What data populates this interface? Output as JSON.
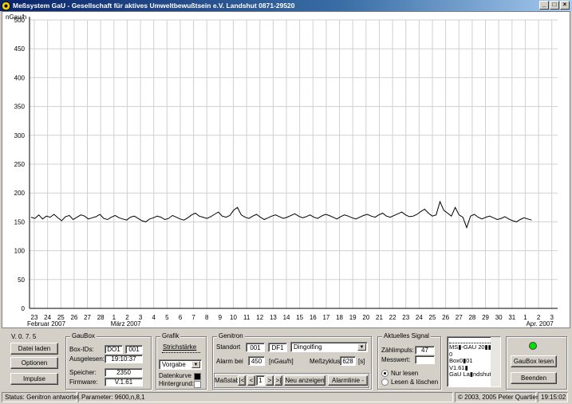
{
  "title": "Meßsystem GaU - Gesellschaft für aktives Umweltbewußtsein e.V.  Landshut 0871-29520",
  "window_buttons": {
    "min": "_",
    "max": "□",
    "close": "×"
  },
  "chart_data": {
    "type": "line",
    "ylabel": "nGau/h",
    "ylim": [
      0,
      500
    ],
    "yticks": [
      0,
      50,
      100,
      150,
      200,
      250,
      300,
      350,
      400,
      450,
      500
    ],
    "x_day_labels": [
      "23",
      "24",
      "25",
      "26",
      "27",
      "28",
      "1",
      "2",
      "3",
      "4",
      "5",
      "6",
      "7",
      "8",
      "9",
      "10",
      "11",
      "12",
      "13",
      "14",
      "15",
      "16",
      "17",
      "18",
      "19",
      "20",
      "21",
      "22",
      "23",
      "24",
      "25",
      "26",
      "27",
      "28",
      "29",
      "30",
      "31",
      "1",
      "2",
      "3"
    ],
    "month_labels": [
      "Februar 2007",
      "März 2007",
      "Apr. 2007"
    ],
    "grid": true,
    "series": [
      {
        "color": "#000000",
        "values": [
          158,
          156,
          162,
          155,
          160,
          158,
          163,
          157,
          152,
          159,
          161,
          154,
          158,
          162,
          160,
          155,
          157,
          159,
          163,
          156,
          154,
          158,
          161,
          157,
          155,
          153,
          158,
          160,
          156,
          152,
          150,
          155,
          157,
          160,
          158,
          154,
          156,
          161,
          158,
          155,
          153,
          157,
          162,
          165,
          160,
          158,
          156,
          159,
          163,
          167,
          160,
          158,
          161,
          170,
          175,
          162,
          158,
          156,
          160,
          163,
          158,
          154,
          157,
          160,
          162,
          159,
          156,
          158,
          161,
          164,
          160,
          157,
          159,
          162,
          158,
          156,
          160,
          163,
          161,
          158,
          155,
          159,
          162,
          160,
          157,
          155,
          158,
          161,
          163,
          160,
          158,
          162,
          165,
          160,
          158,
          161,
          164,
          167,
          162,
          159,
          160,
          163,
          168,
          172,
          165,
          160,
          162,
          185,
          170,
          165,
          160,
          175,
          162,
          158,
          140,
          160,
          163,
          158,
          155,
          158,
          160,
          157,
          154,
          156,
          159,
          155,
          152,
          150,
          154,
          157,
          155,
          153
        ]
      }
    ]
  },
  "version": "V.  0. 7. 5",
  "buttons": {
    "datei_laden": "Datei laden",
    "optionen": "Optionen",
    "impulse": "Impulse",
    "gaubox_lesen": "GauBox lesen",
    "beenden": "Beenden",
    "neu_anzeigen": "Neu anzeigen",
    "alarmlinie": "Alarmlinie -"
  },
  "gaubox": {
    "title": "GauBox",
    "box_ids_label": "Box-IDs:",
    "box_id_1": "DO1",
    "box_id_2": "001",
    "ausgelesen_label": "Ausgelesen:",
    "ausgelesen": "19:10:37",
    "speicher_label": "Speicher:",
    "speicher": "2350",
    "firmware_label": "Firmware:",
    "firmware": "V.1.61"
  },
  "grafik": {
    "title": "Grafik",
    "strichstaerke": "Strichstärke",
    "vorgabe": "Vorgabe",
    "datenkurve": "Datenkurve",
    "hintergrund": "Hintergrund:"
  },
  "genitron": {
    "title": "Genitron",
    "standort_label": "Standort",
    "standort_nr": "001",
    "standort_code": "DF1",
    "standort_name": "Dingolfing",
    "alarm_label": "Alarm bei",
    "alarm_value": "450",
    "alarm_unit": "[nGau/h]",
    "messzyklus_label": "Meßzyklus",
    "messzyklus": "628",
    "messzyklus_unit": "[s]",
    "massstab_label": "Maßstab",
    "nav_first": "|<",
    "nav_prev": "<",
    "nav_value": "1",
    "nav_next": ">",
    "nav_last": ">|"
  },
  "signal": {
    "title": "Aktuelles Signal",
    "zaehlimpuls_label": "Zählimpuls:",
    "zaehlimpuls": "47",
    "messwert_label": "Messwert:",
    "messwert": "",
    "nur_lesen": "Nur lesen",
    "lesen_loeschen": "Lesen & löschen"
  },
  "log_lines": [
    "MS▮-GAU 20▮▮",
    "0",
    "Box0▮01",
    "V1.61▮",
    "GaU La▮ndshut"
  ],
  "status": {
    "left": "Status: Genitron antwortet.",
    "params": "Parameter: 9600,n,8,1",
    "copyright": "© 2003, 2005 Peter Quartier",
    "time": "19:15:02"
  },
  "colors": {
    "led": "#00e000",
    "title_start": "#0a246a"
  }
}
